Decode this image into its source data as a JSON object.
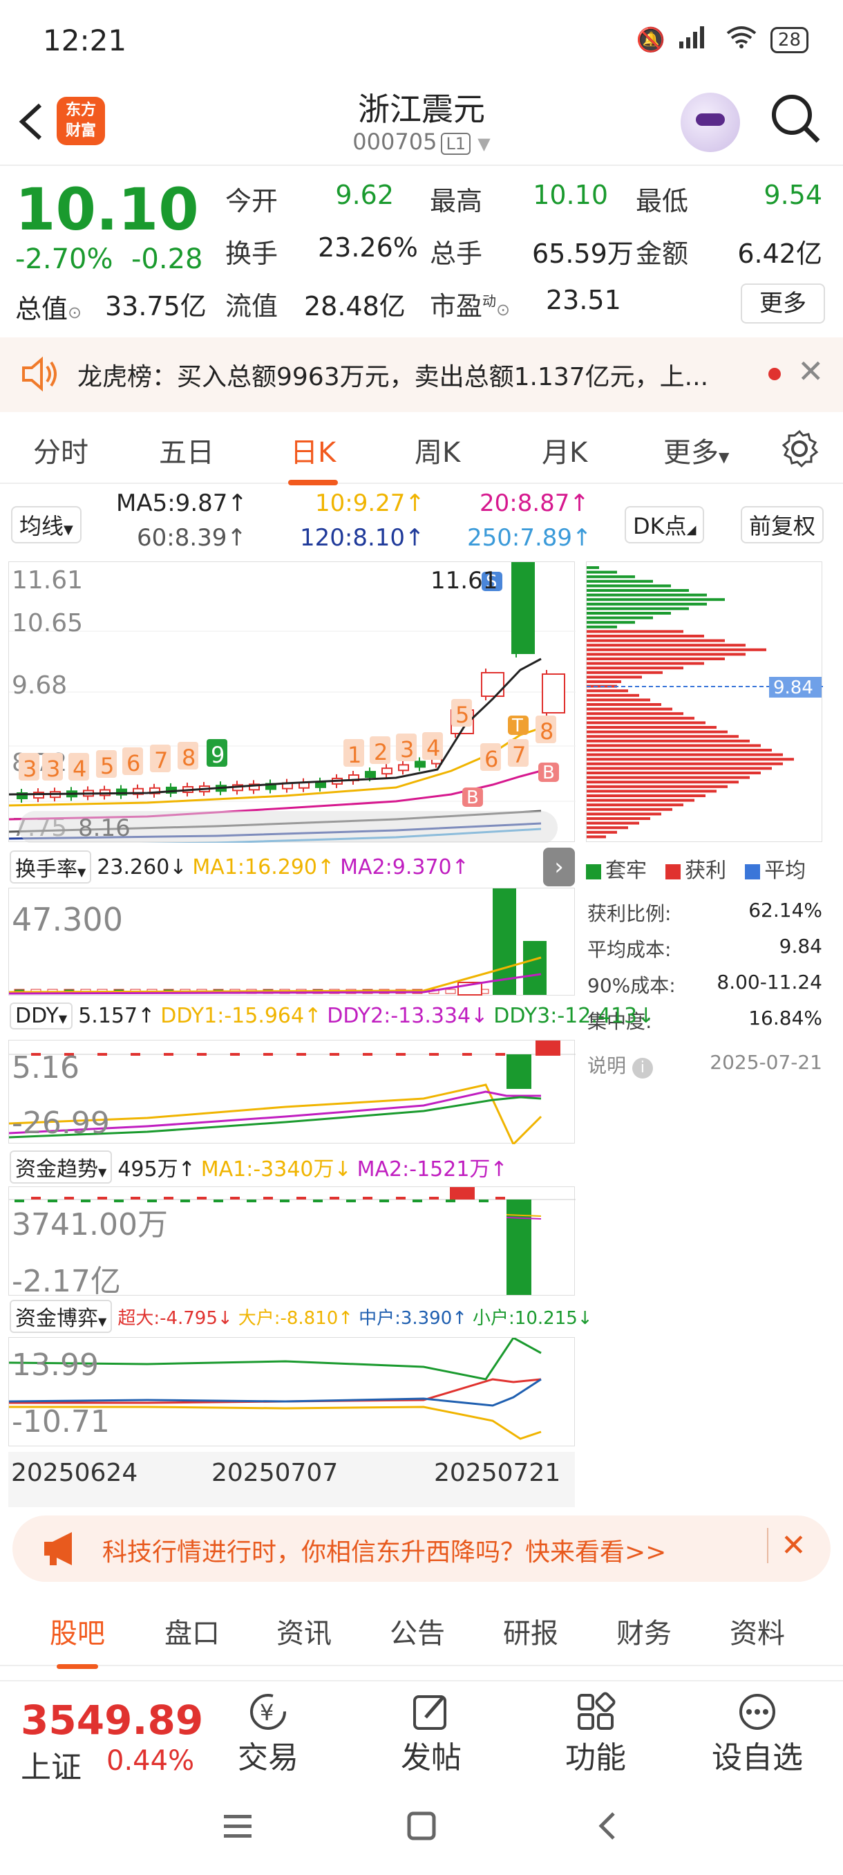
{
  "status_bar": {
    "time": "12:21",
    "battery": "28"
  },
  "header": {
    "back_icon": "back-arrow-icon",
    "logo_line1": "东方",
    "logo_line2": "财富",
    "title": "浙江震元",
    "code": "000705",
    "level": "L1"
  },
  "quote": {
    "price": "10.10",
    "change_pct": "-2.70%",
    "change_amt": "-0.28",
    "fields": [
      {
        "label": "今开",
        "value": "9.62",
        "color": "green"
      },
      {
        "label": "最高",
        "value": "10.10",
        "color": "green"
      },
      {
        "label": "最低",
        "value": "9.54",
        "color": "green"
      },
      {
        "label": "换手",
        "value": "23.26%",
        "color": "black"
      },
      {
        "label": "总手",
        "value": "65.59万",
        "color": "black"
      },
      {
        "label": "金额",
        "value": "6.42亿",
        "color": "black"
      },
      {
        "label": "总值",
        "value": "33.75亿",
        "color": "black"
      },
      {
        "label": "流值",
        "value": "28.48亿",
        "color": "black"
      },
      {
        "label": "市盈",
        "value": "23.51",
        "color": "black"
      }
    ],
    "pe_sup": "动",
    "more": "更多"
  },
  "news": {
    "text": "龙虎榜：买入总额9963万元，卖出总额1.137亿元，上..."
  },
  "tabs": [
    "分时",
    "五日",
    "日K",
    "周K",
    "月K",
    "更多"
  ],
  "active_tab": "日K",
  "ma": {
    "selector": "均线",
    "ma5": "MA5:9.87↑",
    "ma10": "10:9.27↑",
    "ma20": "20:8.87↑",
    "ma60": "60:8.39↑",
    "ma120": "120:8.10↑",
    "ma250": "250:7.89↑",
    "dk": "DK点",
    "fq": "前复权"
  },
  "kline": {
    "y_labels": [
      "11.61",
      "10.65",
      "9.68",
      "8.72",
      "7.75"
    ],
    "hi_label": "11.61",
    "lo_label": "8.16",
    "nums": [
      "3",
      "3",
      "4",
      "5",
      "6",
      "7",
      "8",
      "9",
      "1",
      "2",
      "3",
      "4",
      "5",
      "6",
      "7",
      "8"
    ],
    "marks": {
      "s": "S",
      "b": "B",
      "t": "T"
    },
    "colors": {
      "up": "#e0322f",
      "down": "#1a9a2e",
      "ma5": "#222222",
      "ma10": "#f0b400",
      "ma20": "#d6188e",
      "ma60": "#555555",
      "ma120": "#1f3a9a",
      "ma250": "#3a9ad9"
    }
  },
  "chips": {
    "price_tag": "9.84",
    "legend": [
      "套牢",
      "获利",
      "平均"
    ],
    "stats": [
      {
        "label": "获利比例:",
        "value": "62.14%"
      },
      {
        "label": "平均成本:",
        "value": "9.84"
      },
      {
        "label": "90%成本:",
        "value": "8.00-11.24"
      },
      {
        "label": "集中度:",
        "value": "16.84%"
      }
    ],
    "note": "说明",
    "date": "2025-07-21"
  },
  "turnover": {
    "sel": "换手率",
    "val": "23.260↓",
    "ma1": "MA1:16.290↑",
    "ma2": "MA2:9.370↑",
    "axis": "47.300"
  },
  "ddy": {
    "sel": "DDY",
    "val": "5.157↑",
    "d1": "DDY1:-15.964↑",
    "d2": "DDY2:-13.334↓",
    "d3": "DDY3:-12.413↓",
    "top": "5.16",
    "bot": "-26.99"
  },
  "fund": {
    "sel": "资金趋势",
    "val": "495万↑",
    "ma1": "MA1:-3340万↓",
    "ma2": "MA2:-1521万↑",
    "top": "3741.00万",
    "bot": "-2.17亿"
  },
  "game": {
    "sel": "资金博弈",
    "s1": "超大:-4.795↓",
    "s2": "大户:-8.810↑",
    "s3": "中户:3.390↑",
    "s4": "小户:10.215↓",
    "top": "13.99",
    "bot": "-10.71"
  },
  "dates": [
    "20250624",
    "20250707",
    "20250721"
  ],
  "ad": {
    "text": "科技行情进行时，你相信东升西降吗？快来看看>>"
  },
  "bottom_tabs": [
    "股吧",
    "盘口",
    "资讯",
    "公告",
    "研报",
    "财务",
    "资料"
  ],
  "bottom_bar": {
    "index_value": "3549.89",
    "index_name": "上证",
    "index_chg": "0.44%",
    "items": [
      "交易",
      "发帖",
      "功能",
      "设自选"
    ]
  }
}
